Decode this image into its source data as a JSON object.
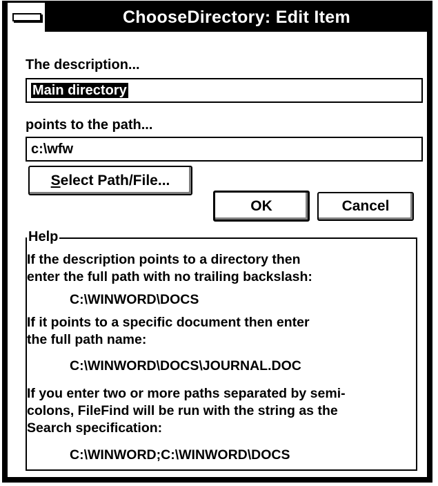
{
  "window": {
    "title": "ChooseDirectory: Edit Item"
  },
  "form": {
    "description_label": "The description...",
    "description_value": "Main directory",
    "path_label": "points to the path...",
    "path_value": "c:\\wfw",
    "select_button_prefix": "",
    "select_button_mnemonic": "S",
    "select_button_rest": "elect Path/File...",
    "ok_label": "OK",
    "cancel_label": "Cancel"
  },
  "help": {
    "group_title": "Help",
    "line1": "If the description points to a directory then",
    "line2": "enter the full path with no trailing backslash:",
    "example1": "C:\\WINWORD\\DOCS",
    "line3": "If it points to a specific document then enter",
    "line4": "the full path name:",
    "example2": "C:\\WINWORD\\DOCS\\JOURNAL.DOC",
    "line5": "If you enter two or more paths separated by semi-",
    "line6": "colons, FileFind will be run with the string as the",
    "line7": "Search specification:",
    "example3": "C:\\WINWORD;C:\\WINWORD\\DOCS"
  }
}
